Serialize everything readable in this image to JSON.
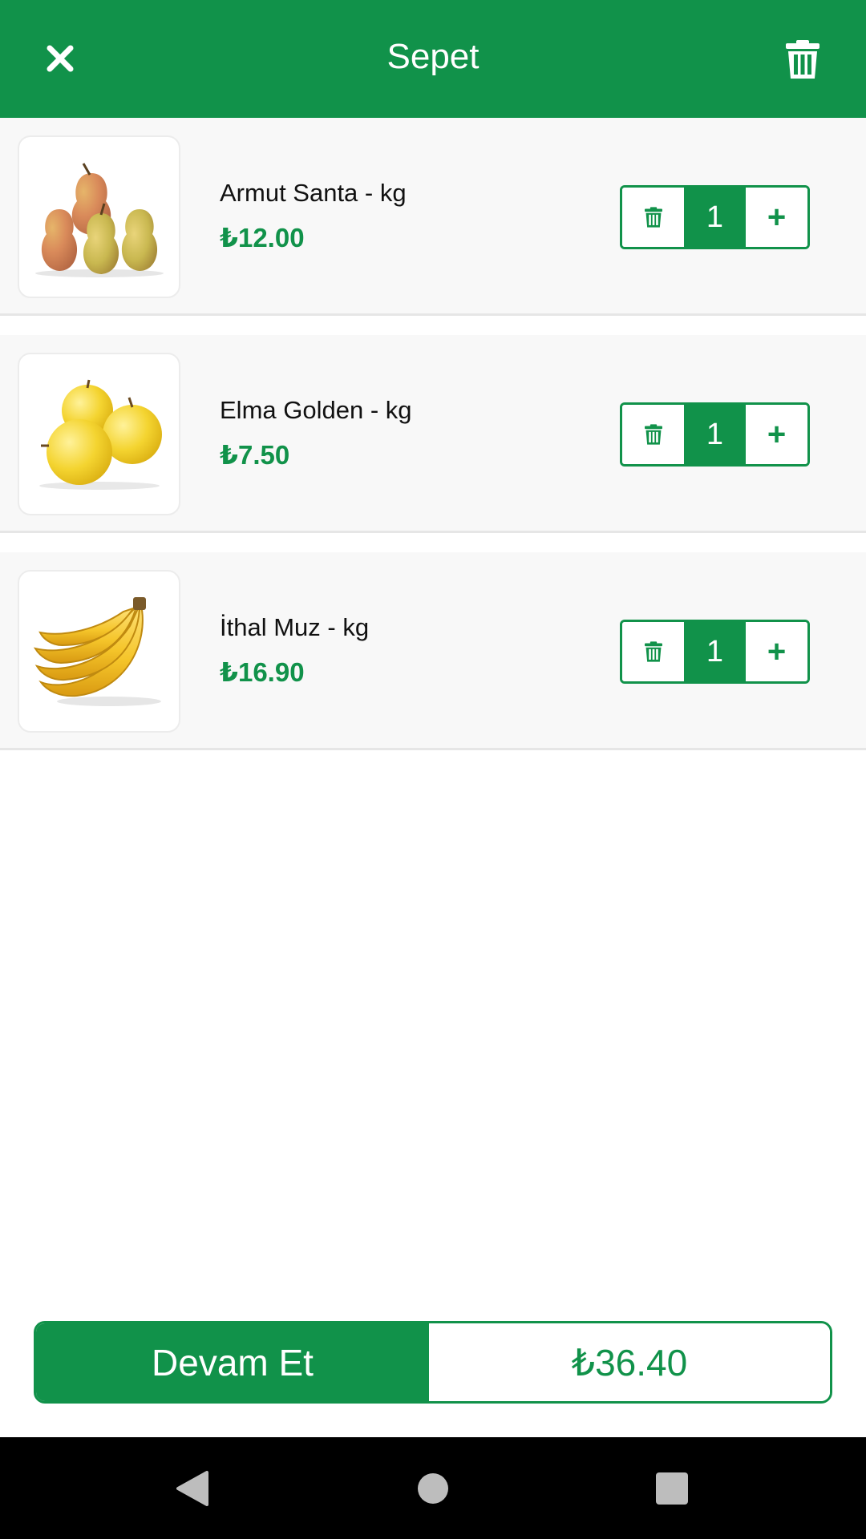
{
  "header": {
    "title": "Sepet",
    "close_icon": "close-icon",
    "clear_icon": "trash-icon",
    "background": "#11924a"
  },
  "cart": {
    "items": [
      {
        "name": "Armut Santa - kg",
        "price": "₺12.00",
        "quantity": "1",
        "image": "pears-image"
      },
      {
        "name": "Elma Golden - kg",
        "price": "₺7.50",
        "quantity": "1",
        "image": "golden-apples-image"
      },
      {
        "name": "İthal Muz - kg",
        "price": "₺16.90",
        "quantity": "1",
        "image": "bananas-image"
      }
    ]
  },
  "checkout": {
    "continue_label": "Devam Et",
    "total": "₺36.40"
  },
  "colors": {
    "accent": "#11924a",
    "item_background": "#f8f8f8"
  },
  "navbar": {
    "back_icon": "back-triangle-icon",
    "home_icon": "home-circle-icon",
    "recents_icon": "recents-square-icon"
  }
}
